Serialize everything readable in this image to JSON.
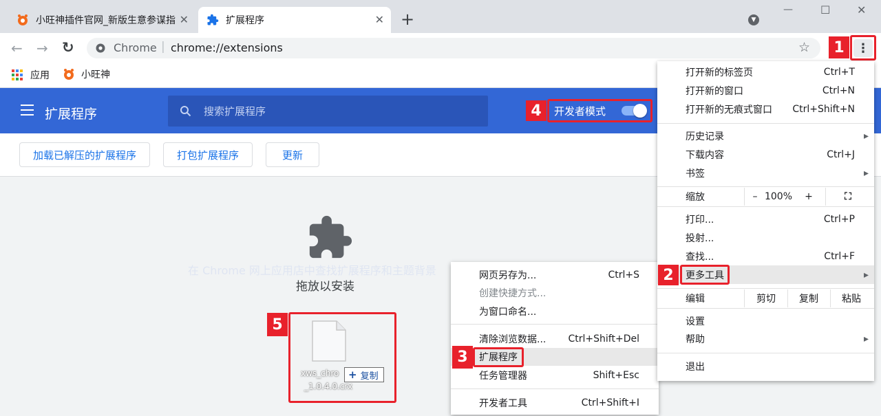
{
  "tabs": [
    {
      "title": "小旺神插件官网_新版生意参谋指",
      "close": "✕"
    },
    {
      "title": "扩展程序",
      "close": "✕"
    }
  ],
  "new_tab": "+",
  "window_controls": {
    "minimize": "—",
    "maximize": "☐",
    "close": "✕"
  },
  "nav": {
    "back": "←",
    "forward": "→",
    "reload": "↻"
  },
  "omnibox": {
    "site": "Chrome",
    "url": "chrome://extensions",
    "star": "☆"
  },
  "menu_button": "⋮",
  "bookmarks": [
    {
      "label": "应用"
    },
    {
      "label": "小旺神"
    }
  ],
  "extensions": {
    "title": "扩展程序",
    "search_placeholder": "搜索扩展程序",
    "dev_mode_label": "开发者模式",
    "dev_mode_on": true,
    "buttons": [
      "加载已解压的扩展程序",
      "打包扩展程序",
      "更新"
    ],
    "faint_link": "在 Chrome 网上应用店中查找扩展程序和主题背景",
    "drop_label": "拖放以安装",
    "file_name_line1": "xws_chro",
    "file_name_line2": "_1.0.4.0.crx",
    "copy_label": "复制",
    "copy_plus": "+"
  },
  "chrome_menu": {
    "group1": [
      {
        "label": "打开新的标签页",
        "shortcut": "Ctrl+T"
      },
      {
        "label": "打开新的窗口",
        "shortcut": "Ctrl+N"
      },
      {
        "label": "打开新的无痕式窗口",
        "shortcut": "Ctrl+Shift+N"
      }
    ],
    "group2": [
      {
        "label": "历史记录",
        "shortcut": "▸"
      },
      {
        "label": "下载内容",
        "shortcut": "Ctrl+J"
      },
      {
        "label": "书签",
        "shortcut": "▸"
      }
    ],
    "zoom": {
      "label": "缩放",
      "minus": "–",
      "value": "100%",
      "plus": "+",
      "full": "⛶"
    },
    "group3": [
      {
        "label": "打印...",
        "shortcut": "Ctrl+P"
      },
      {
        "label": "投射...",
        "shortcut": ""
      },
      {
        "label": "查找...",
        "shortcut": "Ctrl+F"
      },
      {
        "label": "更多工具",
        "shortcut": "▸"
      }
    ],
    "edit": {
      "label": "编辑",
      "cut": "剪切",
      "copy": "复制",
      "paste": "粘贴"
    },
    "group4": [
      {
        "label": "设置",
        "shortcut": ""
      },
      {
        "label": "帮助",
        "shortcut": "▸"
      }
    ],
    "exit": "退出"
  },
  "more_tools_menu": [
    {
      "label": "网页另存为...",
      "shortcut": "Ctrl+S"
    },
    {
      "label": "创建快捷方式...",
      "shortcut": ""
    },
    {
      "label": "为窗口命名...",
      "shortcut": ""
    },
    {
      "label": "清除浏览数据...",
      "shortcut": "Ctrl+Shift+Del"
    },
    {
      "label": "扩展程序",
      "shortcut": ""
    },
    {
      "label": "任务管理器",
      "shortcut": "Shift+Esc"
    },
    {
      "label": "开发者工具",
      "shortcut": "Ctrl+Shift+I"
    }
  ],
  "step_badges": [
    "1",
    "2",
    "3",
    "4",
    "5"
  ],
  "colors": {
    "accent": "#3367d6",
    "highlight": "#e8212b",
    "link": "#1a73e8"
  }
}
